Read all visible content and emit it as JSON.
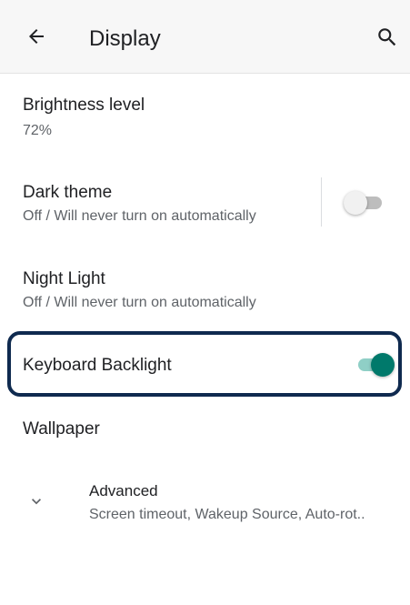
{
  "appbar": {
    "title": "Display",
    "back_icon": "arrow-back-icon",
    "search_icon": "search-icon"
  },
  "settings": {
    "brightness": {
      "title": "Brightness level",
      "summary": "72%"
    },
    "dark_theme": {
      "title": "Dark theme",
      "summary": "Off / Will never turn on automatically",
      "enabled": false
    },
    "night_light": {
      "title": "Night Light",
      "summary": "Off / Will never turn on automatically"
    },
    "keyboard_backlight": {
      "title": "Keyboard Backlight",
      "enabled": true
    },
    "wallpaper": {
      "title": "Wallpaper"
    },
    "advanced": {
      "title": "Advanced",
      "summary": "Screen timeout, Wakeup Source, Auto-rot..",
      "icon": "chevron-down-icon"
    }
  },
  "colors": {
    "accent": "#00796b",
    "highlight_border": "#0f2a4f"
  }
}
